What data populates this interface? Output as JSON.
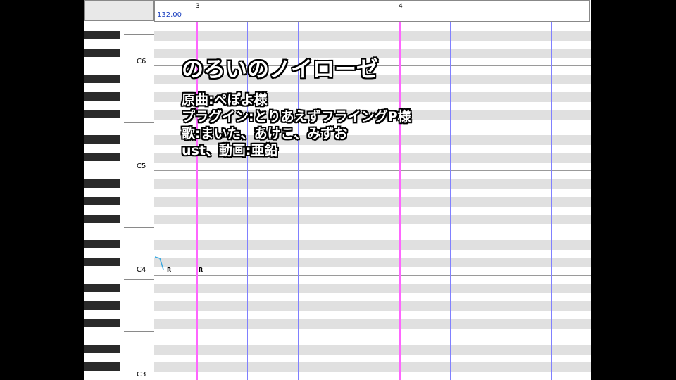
{
  "overlay": {
    "title": "のろいのノイローゼ",
    "credits": [
      "原曲:ぺぽよ様",
      "プラグイン:とりあえずフライングP様",
      "歌:まいた、あけこ、みずお",
      "ust、動画:亜鉛"
    ]
  },
  "ruler": {
    "tempo": "132.00",
    "measures": [
      "3",
      "4"
    ]
  },
  "piano": {
    "octave_labels": [
      "C6",
      "C5",
      "C4",
      "C3"
    ]
  },
  "notes": {
    "lyrics": [
      "R",
      "R"
    ]
  },
  "colors": {
    "measure_line": "#ff66ff",
    "beat_line": "#8080ff",
    "tempo_text": "#1a3fbf",
    "row_gray": "#e0e0e0"
  }
}
